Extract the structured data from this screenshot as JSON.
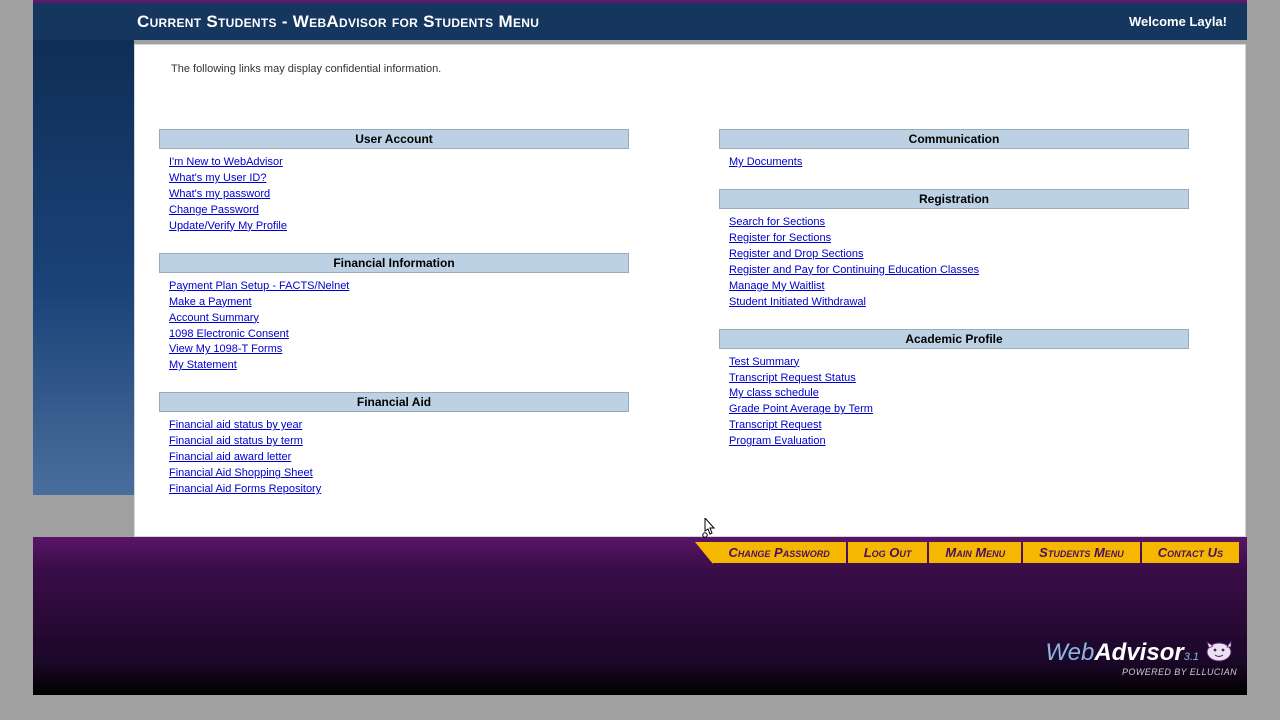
{
  "header": {
    "title": "Current Students - WebAdvisor for Students Menu",
    "welcome": "Welcome Layla!"
  },
  "confidential_notice": "The following links may display confidential information.",
  "left_sections": [
    {
      "title": "User Account",
      "links": [
        "I'm New to WebAdvisor",
        "What's my User ID?",
        "What's my password",
        "Change Password",
        "Update/Verify My Profile"
      ]
    },
    {
      "title": "Financial Information",
      "links": [
        "Payment Plan Setup - FACTS/Nelnet",
        "Make a Payment",
        "Account Summary",
        "1098 Electronic Consent",
        "View My 1098-T Forms",
        "My Statement"
      ]
    },
    {
      "title": "Financial Aid",
      "links": [
        "Financial aid status by year",
        "Financial aid status by term",
        "Financial aid award letter",
        "Financial Aid Shopping Sheet",
        "Financial Aid Forms Repository"
      ]
    }
  ],
  "right_sections": [
    {
      "title": "Communication",
      "links": [
        "My Documents"
      ]
    },
    {
      "title": "Registration",
      "links": [
        "Search for Sections",
        "Register for Sections",
        "Register and Drop Sections",
        "Register and Pay for Continuing Education Classes",
        "Manage My Waitlist",
        "Student Initiated Withdrawal"
      ]
    },
    {
      "title": "Academic Profile",
      "links": [
        "Test Summary",
        "Transcript Request Status",
        "My class schedule",
        "Grade Point Average by Term",
        "Transcript Request",
        "Program Evaluation"
      ]
    }
  ],
  "nav": [
    "Change Password",
    "Log Out",
    "Main Menu",
    "Students Menu",
    "Contact Us"
  ],
  "footer": {
    "web": "Web",
    "advisor": "Advisor",
    "version": "3.1",
    "powered": "POWERED BY ELLUCIAN"
  }
}
